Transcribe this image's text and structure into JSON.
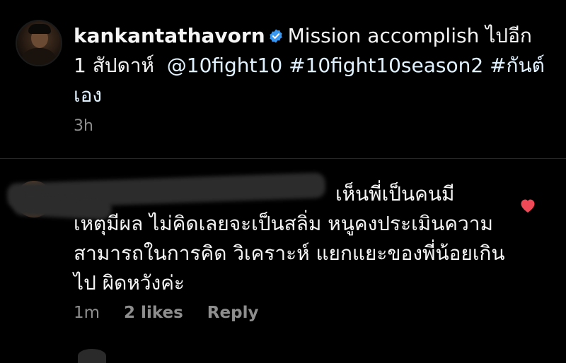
{
  "post": {
    "username": "kankantathavorn",
    "caption_text": "Mission accomplish ไปอีก 1 สัปดาห์",
    "mention": "@10fight10",
    "hashtags": [
      "#10fight10season2",
      "#กันต์เอง"
    ],
    "time": "3h"
  },
  "comment": {
    "text_first_line": "เห็นพี่เป็นคนมี",
    "text_rest": "เหตุมีผล ไม่คิดเลยจะเป็นสลิ่ม หนูคงประเมินความสามารถในการคิด วิเคราะห์ แยกแยะของพี่น้อยเกินไป ผิดหวังค่ะ",
    "time": "1m",
    "likes": "2 likes",
    "reply_label": "Reply",
    "liked": true
  },
  "colors": {
    "background": "#000000",
    "text": "#f5f5f5",
    "secondary": "#8e8e8e",
    "verified": "#3897f0",
    "heart": "#ed4956"
  }
}
